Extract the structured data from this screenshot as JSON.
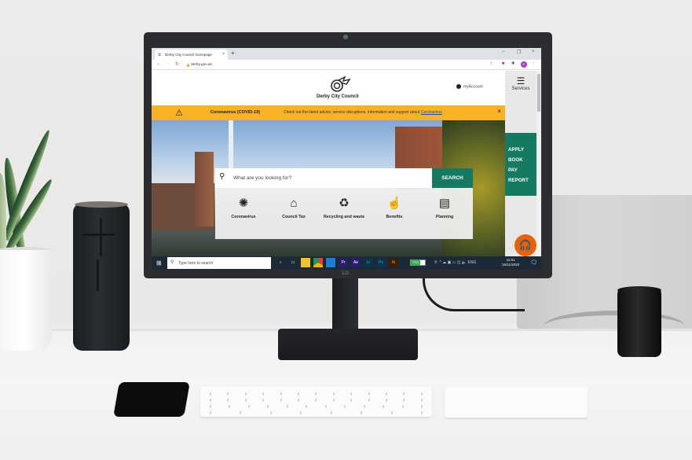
{
  "browser": {
    "tab_title": "Derby City Council homepage",
    "tab_close": "×",
    "new_tab": "+",
    "window_controls": [
      "–",
      "❐",
      "×"
    ],
    "url": "derby.gov.uk",
    "nav_icons": [
      "arrow-left-icon",
      "arrow-right-icon",
      "reload-icon"
    ],
    "profile_initial": "D",
    "profile_color": "#a43bc5"
  },
  "site": {
    "logo_text": "Derby City Council",
    "account_label": "myAccount",
    "services_label": "Services",
    "banner": {
      "title": "Coronavirus (COVID-19)",
      "message": "Check out the latest advice, service disruptions, information and support about",
      "link": "Coronavirus",
      "close": "x",
      "color": "#f8b226"
    },
    "search": {
      "placeholder": "What are you looking for?",
      "button": "SEARCH",
      "button_color": "#167a63"
    },
    "tiles": [
      {
        "label": "Coronavirus",
        "icon": "virus-icon"
      },
      {
        "label": "Council Tax",
        "icon": "house-pound-icon"
      },
      {
        "label": "Recycling and waste",
        "icon": "wheelie-bin-icon"
      },
      {
        "label": "Benefits",
        "icon": "hand-coins-icon"
      },
      {
        "label": "Planning",
        "icon": "map-icon"
      }
    ],
    "quick_links": [
      "APPLY",
      "BOOK",
      "PAY",
      "REPORT"
    ],
    "quick_color": "#167a63",
    "assist_color": "#e8610c"
  },
  "taskbar": {
    "search_placeholder": "Type here to search",
    "apps": [
      "Cortana",
      "Task View",
      "File Explorer",
      "Chrome",
      "Mail",
      "Pr",
      "Ae",
      "Lr",
      "Ps",
      "Ai"
    ],
    "battery": "71%",
    "language": "ENG",
    "time": "11:51",
    "date": "16/11/2020"
  },
  "monitor": {
    "brand": "LG"
  }
}
